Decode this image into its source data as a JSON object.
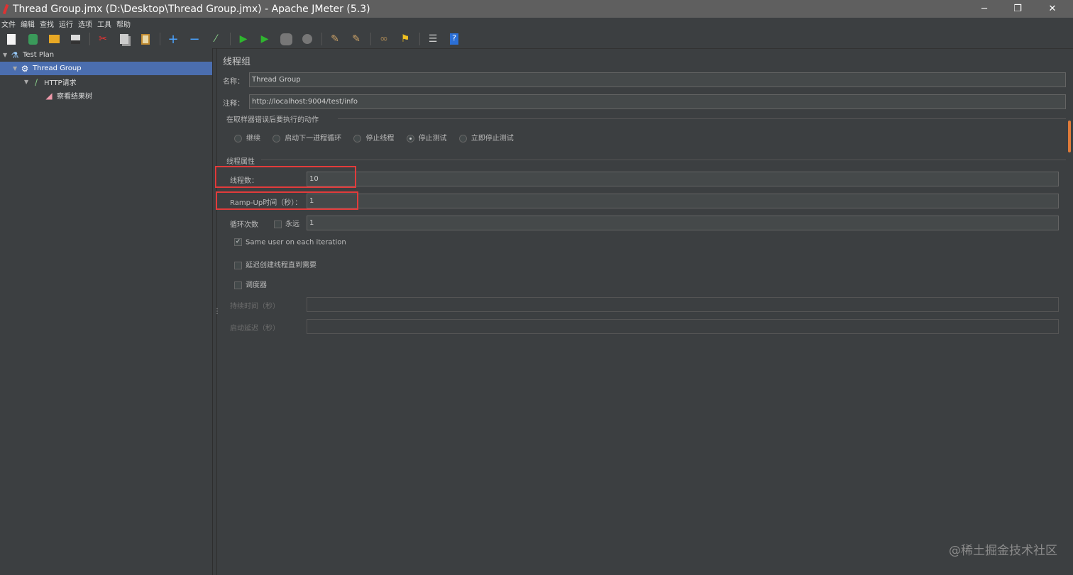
{
  "window": {
    "title": "Thread Group.jmx (D:\\Desktop\\Thread Group.jmx) - Apache JMeter (5.3)",
    "minimize": "─",
    "maximize": "❐",
    "close": "✕"
  },
  "menu": [
    "文件",
    "编辑",
    "查找",
    "运行",
    "选项",
    "工具",
    "帮助"
  ],
  "toolbar": [
    "new-icon",
    "templates-icon",
    "open-icon",
    "save-icon",
    "cut-icon",
    "copy-icon",
    "paste-icon",
    "expand-icon",
    "collapse-icon",
    "toggle-icon",
    "start-icon",
    "start-no-pauses-icon",
    "stop-icon",
    "shutdown-icon",
    "clear-icon",
    "clear-all-icon",
    "search-icon",
    "reset-search-icon",
    "function-helper-icon",
    "help-icon"
  ],
  "tree": [
    {
      "label": "Test Plan",
      "icon": "flask-icon"
    },
    {
      "label": "Thread Group",
      "icon": "gear-icon"
    },
    {
      "label": "HTTP请求",
      "icon": "pipette-icon"
    },
    {
      "label": "察看结果树",
      "icon": "chart-icon"
    }
  ],
  "panel": {
    "title": "线程组",
    "name_label": "名称：",
    "name_value": "Thread Group",
    "comment_label": "注释：",
    "comment_value": "http://localhost:9004/test/info",
    "error_group": "在取样器错误后要执行的动作",
    "error_options": [
      {
        "label": "继续",
        "selected": false
      },
      {
        "label": "启动下一进程循环",
        "selected": false
      },
      {
        "label": "停止线程",
        "selected": false
      },
      {
        "label": "停止测试",
        "selected": true
      },
      {
        "label": "立即停止测试",
        "selected": false
      }
    ],
    "props_group": "线程属性",
    "threads_label": "线程数：",
    "threads_value": "10",
    "rampup_label": "Ramp-Up时间（秒）：",
    "rampup_value": "1",
    "loop_label": "循环次数",
    "forever_label": "永远",
    "forever_checked": false,
    "loop_value": "1",
    "same_user_label": "Same user on each iteration",
    "same_user_checked": true,
    "delay_label": "延迟创建线程直到需要",
    "delay_checked": false,
    "scheduler_label": "调度器",
    "scheduler_checked": false,
    "duration_label": "持续时间（秒）",
    "duration_value": "",
    "startup_delay_label": "启动延迟（秒）",
    "startup_delay_value": ""
  },
  "watermark": "@稀土掘金技术社区"
}
